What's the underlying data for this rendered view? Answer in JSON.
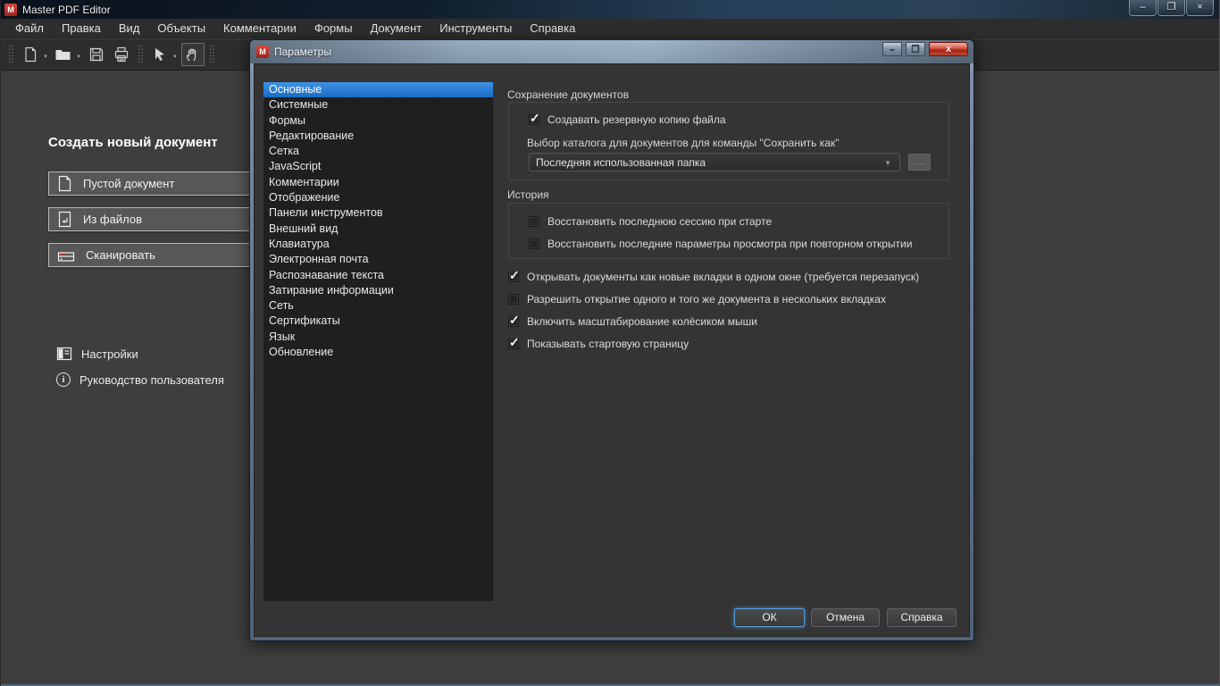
{
  "window": {
    "title": "Master PDF Editor",
    "controls": {
      "minimize": "–",
      "restore": "❐",
      "close": "×"
    }
  },
  "menu": {
    "items": [
      "Файл",
      "Правка",
      "Вид",
      "Объекты",
      "Комментарии",
      "Формы",
      "Документ",
      "Инструменты",
      "Справка"
    ]
  },
  "toolbar": {
    "icons": [
      "new-document-icon",
      "open-folder-icon",
      "save-icon",
      "print-icon",
      "select-arrow-icon",
      "hand-tool-icon"
    ],
    "active_tool": "hand"
  },
  "welcome": {
    "heading": "Создать новый документ",
    "buttons": [
      {
        "label": "Пустой документ",
        "icon": "blank-document-icon"
      },
      {
        "label": "Из файлов",
        "icon": "from-files-icon"
      },
      {
        "label": "Сканировать",
        "icon": "scanner-icon"
      }
    ],
    "links": [
      {
        "label": "Настройки",
        "icon": "settings-icon"
      },
      {
        "label": "Руководство пользователя",
        "icon": "info-icon"
      }
    ]
  },
  "dialog": {
    "title": "Параметры",
    "controls": {
      "minimize": "–",
      "restore": "❐",
      "close": "x"
    },
    "list": {
      "selected_index": 0,
      "items": [
        "Основные",
        "Системные",
        "Формы",
        "Редактирование",
        "Сетка",
        "JavaScript",
        "Комментарии",
        "Отображение",
        "Панели инструментов",
        "Внешний вид",
        "Клавиатура",
        "Электронная почта",
        "Распознавание текста",
        "Затирание информации",
        "Сеть",
        "Сертификаты",
        "Язык",
        "Обновление"
      ]
    },
    "saving": {
      "title": "Сохранение документов",
      "backup": {
        "label": "Создавать резервную копию файла",
        "checked": true,
        "mark": "✓"
      },
      "dir_label": "Выбор каталога для документов для команды \"Сохранить как\"",
      "dir_value": "Последняя использованная папка",
      "combo_arrow": "▼",
      "browse_label": "...."
    },
    "history": {
      "title": "История",
      "checkboxes": [
        {
          "label": "Восстановить последнюю сессию при старте",
          "checked": false,
          "mark": ""
        },
        {
          "label": "Восстановить последние параметры просмотра при повторном открытии",
          "checked": false,
          "mark": ""
        }
      ]
    },
    "options": [
      {
        "label": "Открывать документы как новые вкладки в одном окне (требуется перезапуск)",
        "checked": true,
        "mark": "✓"
      },
      {
        "label": "Разрешить открытие одного и того же документа в нескольких вкладках",
        "checked": false,
        "mark": ""
      },
      {
        "label": "Включить масштабирование колёсиком мыши",
        "checked": true,
        "mark": "✓"
      },
      {
        "label": "Показывать стартовую страницу",
        "checked": true,
        "mark": "✓"
      }
    ],
    "footer": {
      "ok": "ОК",
      "cancel": "Отмена",
      "help": "Справка"
    }
  },
  "colors": {
    "selection_blue": "#1f7ad1",
    "dialog_bg": "#343434",
    "list_bg": "#1f1f1f",
    "window_bg": "#3e3e3e",
    "bar_bg": "#2d2d2d",
    "close_button_red": "#b03122",
    "logo_red": "#c63a2f"
  }
}
